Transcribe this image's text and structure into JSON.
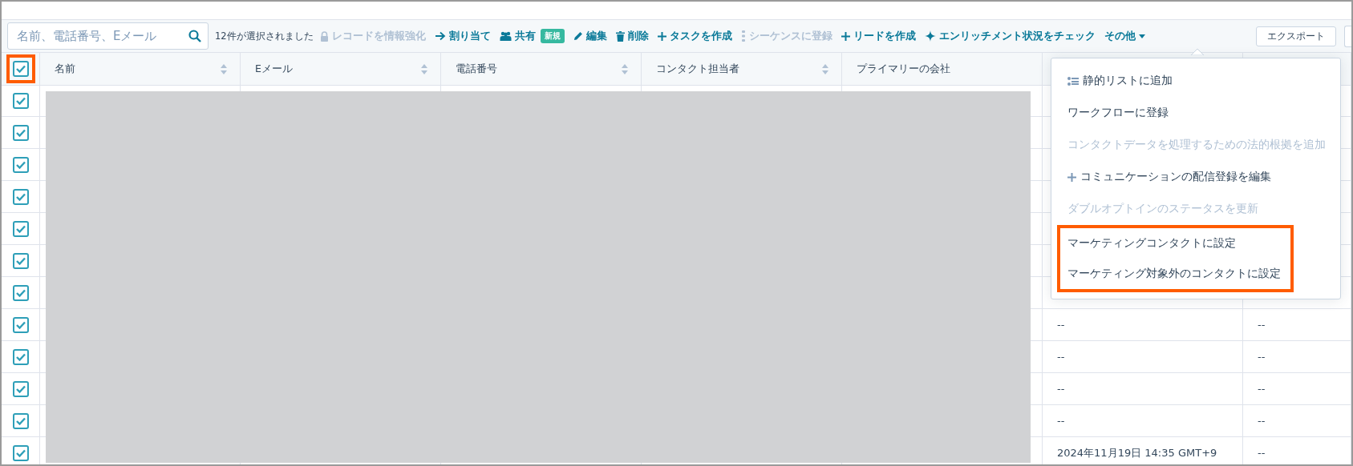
{
  "search": {
    "placeholder": "名前、電話番号、Eメール"
  },
  "selection_count": "12件が選択されました",
  "actions": [
    {
      "label": "レコードを情報強化",
      "kind": "lock",
      "disabled": true
    },
    {
      "label": "割り当て",
      "kind": "arrow",
      "disabled": false
    },
    {
      "label": "共有",
      "kind": "people",
      "disabled": false,
      "badge": "新規"
    },
    {
      "label": "編集",
      "kind": "pencil",
      "disabled": false
    },
    {
      "label": "削除",
      "kind": "trash",
      "disabled": false
    },
    {
      "label": "タスクを作成",
      "kind": "plus",
      "disabled": false
    },
    {
      "label": "シーケンスに登録",
      "kind": "sequence",
      "disabled": true
    },
    {
      "label": "リードを作成",
      "kind": "plus",
      "disabled": false
    },
    {
      "label": "エンリッチメント状況をチェック",
      "kind": "sparkle",
      "disabled": false
    },
    {
      "label": "その他",
      "kind": "dropdown",
      "disabled": false,
      "expanded": true
    }
  ],
  "export_button": "エクスポート",
  "table": {
    "select_all": {
      "checked": true,
      "highlighted": true
    },
    "columns": [
      {
        "label": "名前",
        "sortable": true
      },
      {
        "label": "Eメール",
        "sortable": true
      },
      {
        "label": "電話番号",
        "sortable": true
      },
      {
        "label": "コンタクト担当者",
        "sortable": true
      },
      {
        "label": "プライマリーの会社",
        "sortable": false
      }
    ],
    "rows": [
      {
        "checked": true
      },
      {
        "checked": true
      },
      {
        "checked": true
      },
      {
        "checked": true
      },
      {
        "checked": true
      },
      {
        "checked": true
      },
      {
        "checked": true
      },
      {
        "checked": true,
        "column_6": "--",
        "column_7": "--"
      },
      {
        "checked": true,
        "column_6": "--",
        "column_7": "--"
      },
      {
        "checked": true,
        "column_6": "--",
        "column_7": "--"
      },
      {
        "checked": true,
        "column_6": "--",
        "column_7": "--"
      },
      {
        "checked": true,
        "column_6": "2024年11月19日 14:35 GMT+9",
        "column_7": "--"
      }
    ]
  },
  "menu": {
    "items": [
      {
        "label": "静的リストに追加",
        "kind": "list",
        "disabled": false,
        "highlighted": false
      },
      {
        "label": "ワークフローに登録",
        "kind": "plain",
        "disabled": false,
        "highlighted": false
      },
      {
        "label": "コンタクトデータを処理するための法的根拠を追加",
        "kind": "plain",
        "disabled": true,
        "highlighted": false
      },
      {
        "label": "コミュニケーションの配信登録を編集",
        "kind": "plus",
        "disabled": false,
        "highlighted": false
      },
      {
        "label": "ダブルオプトインのステータスを更新",
        "kind": "plain",
        "disabled": true,
        "highlighted": false
      },
      {
        "label": "マーケティングコンタクトに設定",
        "kind": "plain",
        "disabled": false,
        "highlighted": true
      },
      {
        "label": "マーケティング対象外のコンタクトに設定",
        "kind": "plain",
        "disabled": false,
        "highlighted": true
      }
    ]
  }
}
